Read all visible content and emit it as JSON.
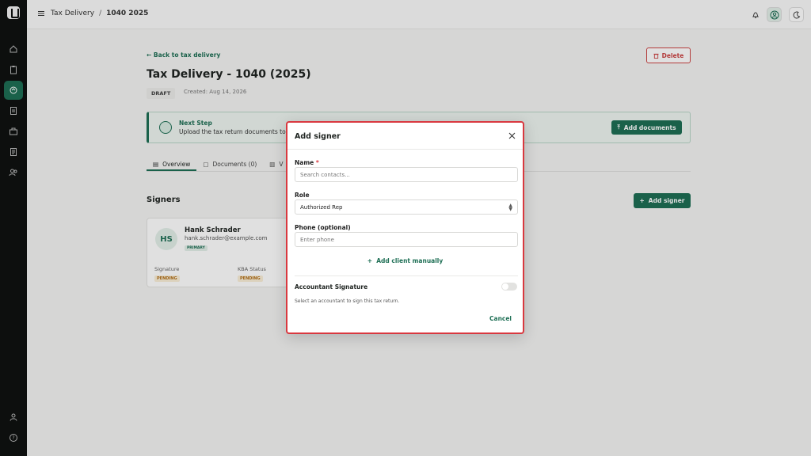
{
  "breadcrumb": {
    "parent": "Tax Delivery",
    "separator": "/",
    "current": "1040 2025"
  },
  "header": {
    "back_label": "Back to tax delivery",
    "delete_label": "Delete",
    "title": "Tax Delivery - 1040 (2025)",
    "status_badge": "DRAFT",
    "created": "Created: Aug 14, 2026"
  },
  "next_step": {
    "title": "Next Step",
    "description": "Upload the tax return documents to p",
    "button_label": "Add documents"
  },
  "tabs": [
    {
      "label": "Overview",
      "icon": "doc-icon"
    },
    {
      "label": "Documents (0)",
      "icon": "file-icon"
    },
    {
      "label": "V",
      "icon": "list-icon"
    }
  ],
  "signers": {
    "heading": "Signers",
    "add_button": "Add signer",
    "items": [
      {
        "initials": "HS",
        "name": "Hank Schrader",
        "email": "hank.schrader@example.com",
        "badge": "PRIMARY",
        "signature_label": "Signature",
        "signature_status": "PENDING",
        "kba_label": "KBA Status",
        "kba_status": "PENDING"
      }
    ]
  },
  "modal": {
    "title": "Add signer",
    "name_label": "Name",
    "name_required": "*",
    "name_placeholder": "Search contacts...",
    "role_label": "Role",
    "role_value": "Authorized Rep",
    "phone_label": "Phone (optional)",
    "phone_placeholder": "Enter phone",
    "add_manual": "Add client manually",
    "accountant_label": "Accountant Signature",
    "accountant_desc": "Select an accountant to sign this tax return.",
    "cancel_label": "Cancel"
  },
  "colors": {
    "accent": "#1e6f55",
    "danger": "#d9383f",
    "sidebar": "#0f1211"
  }
}
